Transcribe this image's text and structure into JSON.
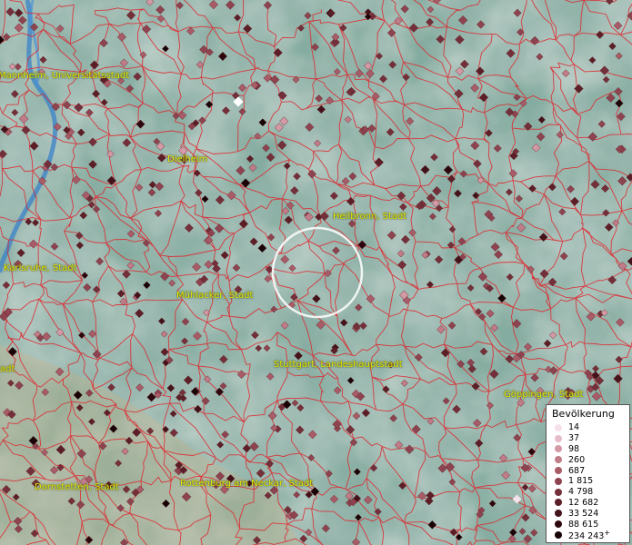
{
  "map": {
    "cities": [
      {
        "id": "mannheim",
        "label": "Mannheim, Universitätsstadt"
      },
      {
        "id": "dielheim",
        "label": "Dielheim"
      },
      {
        "id": "heilbronn",
        "label": "Heilbronn, Stadt"
      },
      {
        "id": "karlsruhe",
        "label": "Karlsruhe, Stadt"
      },
      {
        "id": "muehlacker",
        "label": "Mühlacker, Stadt"
      },
      {
        "id": "stuttgart",
        "label": "Stuttgart, Landeshauptstadt"
      },
      {
        "id": "goeppingen",
        "label": "Göppingen, Stadt"
      },
      {
        "id": "dornstetten",
        "label": "Dornstetten, Stadt"
      },
      {
        "id": "rottenburg",
        "label": "Rottenburg am Neckar, Stadt"
      },
      {
        "id": "edge",
        "label": "adt"
      }
    ],
    "colors": {
      "boundary": "#e0222a",
      "river": "#3a82c8",
      "marker_outline": "#5a1a20",
      "label": "#e8e800"
    }
  },
  "legend": {
    "title": "Bevölkerung",
    "plus": "+",
    "entries": [
      {
        "value": "14",
        "color": "#f6e0ea"
      },
      {
        "value": "37",
        "color": "#e6bcc8"
      },
      {
        "value": "98",
        "color": "#d39aa6"
      },
      {
        "value": "260",
        "color": "#c07c88"
      },
      {
        "value": "687",
        "color": "#a85c68"
      },
      {
        "value": "1 815",
        "color": "#8e4450"
      },
      {
        "value": "4 798",
        "color": "#74303a"
      },
      {
        "value": "12 682",
        "color": "#5c1f28"
      },
      {
        "value": "33 524",
        "color": "#44121a"
      },
      {
        "value": "88 615",
        "color": "#2c080e"
      },
      {
        "value": "234 243",
        "color": "#180306"
      }
    ]
  }
}
